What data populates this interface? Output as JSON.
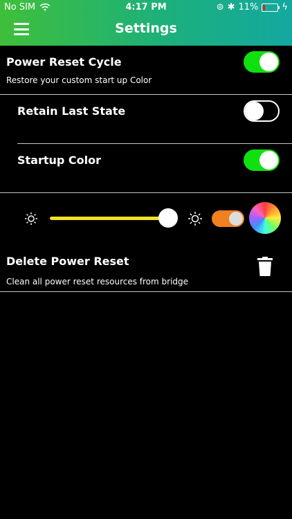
{
  "status": {
    "carrier": "No SIM",
    "time": "4:17 PM",
    "battery": "11%",
    "battery_level": 0.11
  },
  "header": {
    "title": "Settings"
  },
  "power_reset_cycle": {
    "title": "Power Reset Cycle",
    "subtitle": "Restore your custom start up Color",
    "enabled": true
  },
  "retain_last_state": {
    "title": "Retain Last State",
    "enabled": false
  },
  "startup_color": {
    "title": "Startup Color",
    "enabled": true
  },
  "brightness": {
    "level": 1.0
  },
  "mode_toggle": {
    "enabled": true
  },
  "delete_power_reset": {
    "title": "Delete Power Reset",
    "subtitle": "Clean all power reset resources from bridge"
  },
  "colors": {
    "header_start": "#3fbf3a",
    "header_end": "#13a8a0",
    "toggle_on": "#10e010",
    "slider": "#f0e420",
    "mini_toggle": "#f08020"
  }
}
